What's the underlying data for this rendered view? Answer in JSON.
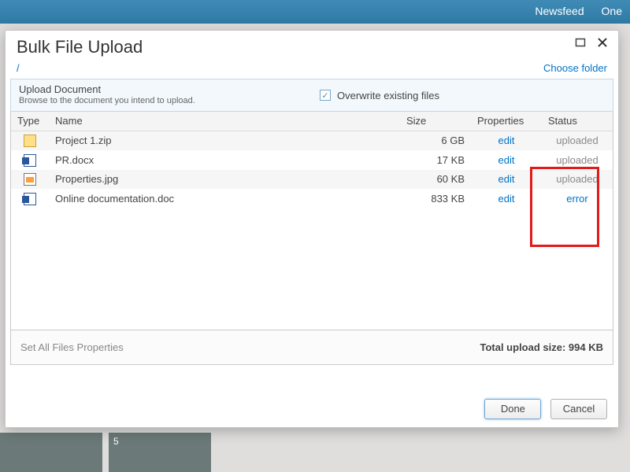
{
  "sitebar": {
    "links": [
      "Newsfeed",
      "One"
    ]
  },
  "dialog": {
    "title": "Bulk File Upload",
    "path": "/",
    "choose_folder": "Choose folder",
    "upload_heading": "Upload Document",
    "upload_sub": "Browse to the document you intend to upload.",
    "overwrite_label": "Overwrite existing files",
    "columns": {
      "type": "Type",
      "name": "Name",
      "size": "Size",
      "properties": "Properties",
      "status": "Status"
    },
    "edit_label": "edit",
    "files": [
      {
        "icon": "zip",
        "name": "Project 1.zip",
        "size": "6 GB",
        "status": "uploaded",
        "status_kind": "uploaded"
      },
      {
        "icon": "doc",
        "name": "PR.docx",
        "size": "17 KB",
        "status": "uploaded",
        "status_kind": "uploaded"
      },
      {
        "icon": "jpg",
        "name": "Properties.jpg",
        "size": "60 KB",
        "status": "uploaded",
        "status_kind": "uploaded"
      },
      {
        "icon": "doc",
        "name": "Online documentation.doc",
        "size": "833 KB",
        "status": "error",
        "status_kind": "error"
      }
    ],
    "set_all_props": "Set All Files Properties",
    "total_label": "Total upload size: ",
    "total_value": "994 KB",
    "done": "Done",
    "cancel": "Cancel"
  },
  "bg_thumb_label": "5"
}
